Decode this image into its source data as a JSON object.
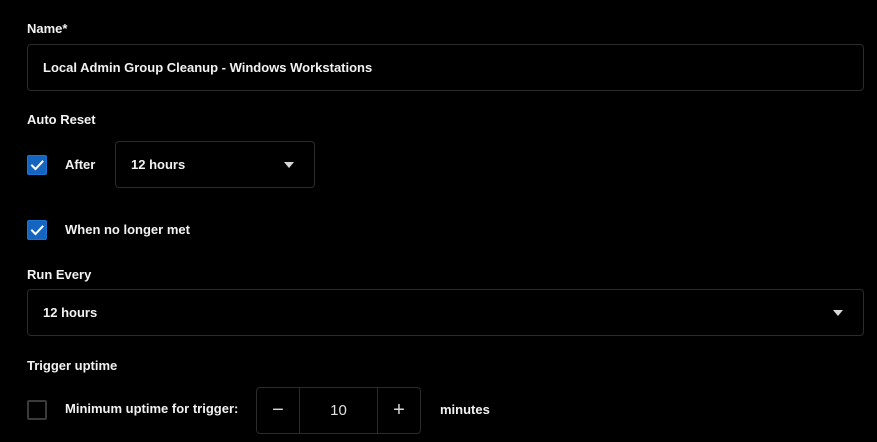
{
  "name_section": {
    "label": "Name*",
    "value": "Local Admin Group Cleanup - Windows Workstations"
  },
  "auto_reset": {
    "label": "Auto Reset",
    "after_checked": true,
    "after_label": "After",
    "after_select_value": "12 hours",
    "no_longer_met_checked": true,
    "no_longer_met_label": "When no longer met"
  },
  "run_every": {
    "label": "Run Every",
    "select_value": "12 hours"
  },
  "trigger_uptime": {
    "label": "Trigger uptime",
    "min_uptime_checked": false,
    "min_uptime_label": "Minimum uptime for trigger:",
    "minus_glyph": "−",
    "plus_glyph": "+",
    "value": "10",
    "unit": "minutes"
  },
  "colors": {
    "background": "#000000",
    "checkbox_checked": "#1565c0",
    "border": "#2b2b2b",
    "text": "#f2f2f2"
  },
  "icons": [
    "check-icon",
    "chevron-down-icon",
    "minus-icon",
    "plus-icon"
  ]
}
